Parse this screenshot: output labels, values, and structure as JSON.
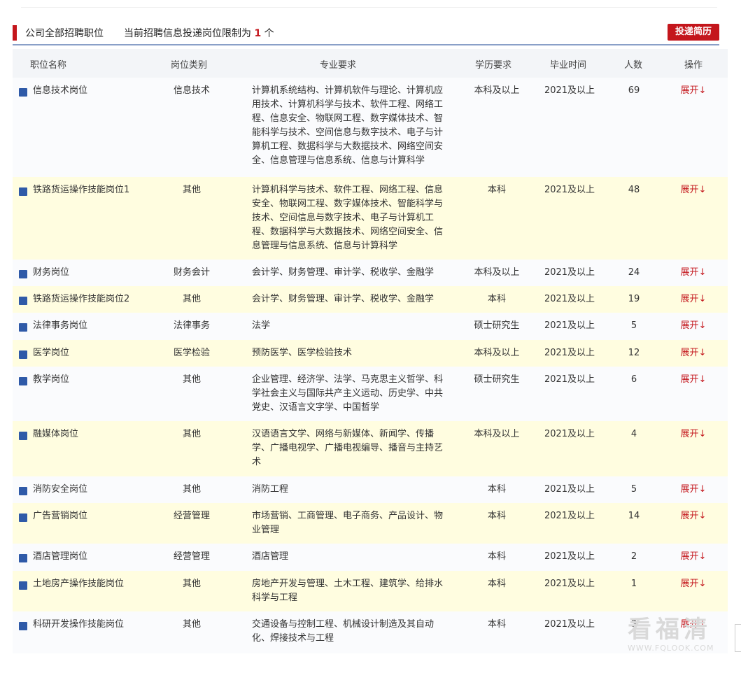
{
  "header": {
    "title": "公司全部招聘职位",
    "notice_prefix": "当前招聘信息投递岗位限制为",
    "notice_count": "1",
    "notice_suffix": "个",
    "submit_label": "投递简历"
  },
  "columns": [
    "职位名称",
    "岗位类别",
    "专业要求",
    "学历要求",
    "毕业时间",
    "人数",
    "操作"
  ],
  "rows": [
    {
      "name": "信息技术岗位",
      "category": "信息技术",
      "majors": "计算机系统结构、计算机软件与理论、计算机应用技术、计算机科学与技术、软件工程、网络工程、信息安全、物联网工程、数字媒体技术、智能科学与技术、空间信息与数字技术、电子与计算机工程、数据科学与大数据技术、网络空间安全、信息管理与信息系统、信息与计算科学",
      "education": "本科及以上",
      "graduation": "2021及以上",
      "count": "69",
      "action": "展开↓"
    },
    {
      "name": "铁路货运操作技能岗位1",
      "category": "其他",
      "majors": "计算机科学与技术、软件工程、网络工程、信息安全、物联网工程、数字媒体技术、智能科学与技术、空间信息与数字技术、电子与计算机工程、数据科学与大数据技术、网络空间安全、信息管理与信息系统、信息与计算科学",
      "education": "本科",
      "graduation": "2021及以上",
      "count": "48",
      "action": "展开↓"
    },
    {
      "name": "财务岗位",
      "category": "财务会计",
      "majors": "会计学、财务管理、审计学、税收学、金融学",
      "education": "本科及以上",
      "graduation": "2021及以上",
      "count": "24",
      "action": "展开↓"
    },
    {
      "name": "铁路货运操作技能岗位2",
      "category": "其他",
      "majors": "会计学、财务管理、审计学、税收学、金融学",
      "education": "本科",
      "graduation": "2021及以上",
      "count": "19",
      "action": "展开↓"
    },
    {
      "name": "法律事务岗位",
      "category": "法律事务",
      "majors": "法学",
      "education": "硕士研究生",
      "graduation": "2021及以上",
      "count": "5",
      "action": "展开↓"
    },
    {
      "name": "医学岗位",
      "category": "医学检验",
      "majors": "预防医学、医学检验技术",
      "education": "本科及以上",
      "graduation": "2021及以上",
      "count": "12",
      "action": "展开↓"
    },
    {
      "name": "教学岗位",
      "category": "其他",
      "majors": "企业管理、经济学、法学、马克思主义哲学、科学社会主义与国际共产主义运动、历史学、中共党史、汉语言文字学、中国哲学",
      "education": "硕士研究生",
      "graduation": "2021及以上",
      "count": "6",
      "action": "展开↓"
    },
    {
      "name": "融媒体岗位",
      "category": "其他",
      "majors": "汉语语言文学、网络与新媒体、新闻学、传播学、广播电视学、广播电视编导、播音与主持艺术",
      "education": "本科及以上",
      "graduation": "2021及以上",
      "count": "4",
      "action": "展开↓"
    },
    {
      "name": "消防安全岗位",
      "category": "其他",
      "majors": "消防工程",
      "education": "本科",
      "graduation": "2021及以上",
      "count": "5",
      "action": "展开↓"
    },
    {
      "name": "广告营销岗位",
      "category": "经营管理",
      "majors": "市场营销、工商管理、电子商务、产品设计、物业管理",
      "education": "本科",
      "graduation": "2021及以上",
      "count": "14",
      "action": "展开↓"
    },
    {
      "name": "酒店管理岗位",
      "category": "经营管理",
      "majors": "酒店管理",
      "education": "本科",
      "graduation": "2021及以上",
      "count": "2",
      "action": "展开↓"
    },
    {
      "name": "土地房产操作技能岗位",
      "category": "其他",
      "majors": "房地产开发与管理、土木工程、建筑学、给排水科学与工程",
      "education": "本科",
      "graduation": "2021及以上",
      "count": "1",
      "action": "展开↓"
    },
    {
      "name": "科研开发操作技能岗位",
      "category": "其他",
      "majors": "交通设备与控制工程、机械设计制造及其自动化、焊接技术与工程",
      "education": "本科",
      "graduation": "2021及以上",
      "count": "3",
      "action": "展开↓"
    }
  ],
  "watermark": {
    "main": "看福清",
    "url": "WWW.FQLOOK.COM"
  }
}
